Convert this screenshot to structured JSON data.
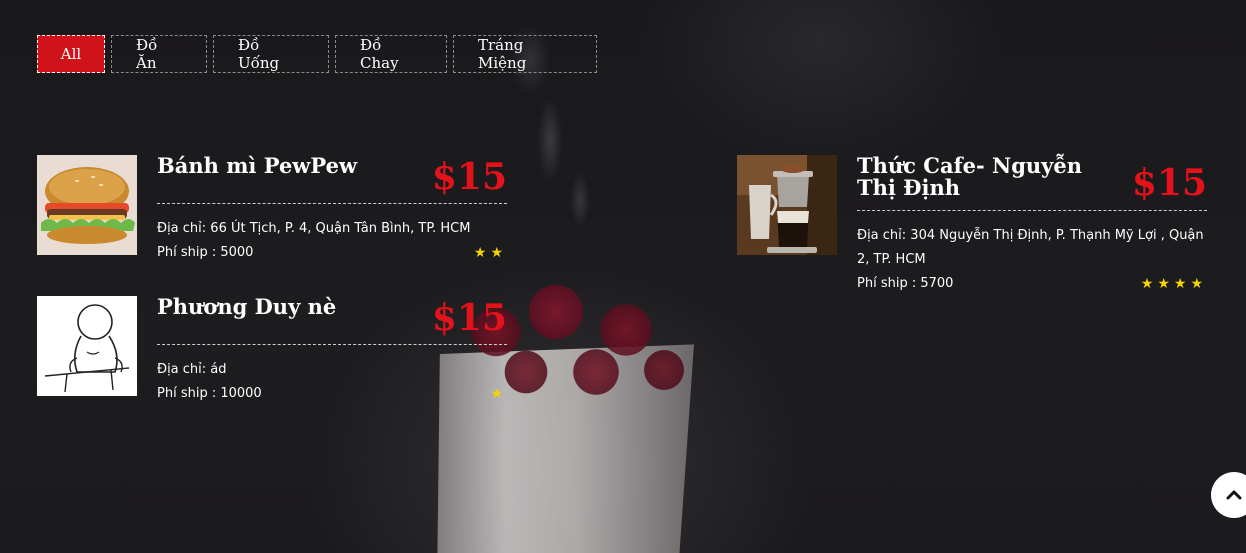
{
  "filters": [
    {
      "label": "All",
      "active": true
    },
    {
      "label": "Đồ Ăn",
      "active": false
    },
    {
      "label": "Đồ Uống",
      "active": false
    },
    {
      "label": "Đồ Chay",
      "active": false
    },
    {
      "label": "Tráng Miệng",
      "active": false
    }
  ],
  "items": [
    {
      "title": "Bánh mì PewPew",
      "price": "$15",
      "address": "Địa chỉ: 66 Út Tịch, P. 4, Quận Tân Bình, TP. HCM",
      "shipping": "Phí ship : 5000",
      "rating": 2,
      "image_icon": "burger-image"
    },
    {
      "title": "Phương Duy nè",
      "price": "$15",
      "address": "Địa chỉ: ád",
      "shipping": "Phí ship : 10000",
      "rating": 1,
      "image_icon": "sketch-figure-image"
    },
    {
      "title": "Thức Cafe- Nguyễn Thị Định",
      "price": "$15",
      "address": "Địa chỉ: 304 Nguyễn Thị Định, P. Thạnh Mỹ Lợi , Quận 2, TP. HCM",
      "shipping": "Phí ship : 5700",
      "rating": 4,
      "image_icon": "phin-coffee-image"
    }
  ],
  "colors": {
    "accent": "#d0121a",
    "price": "#e3121b",
    "star": "#f3d300",
    "background": "#1c1b1e"
  },
  "back_to_top_icon": "chevron-up-icon"
}
